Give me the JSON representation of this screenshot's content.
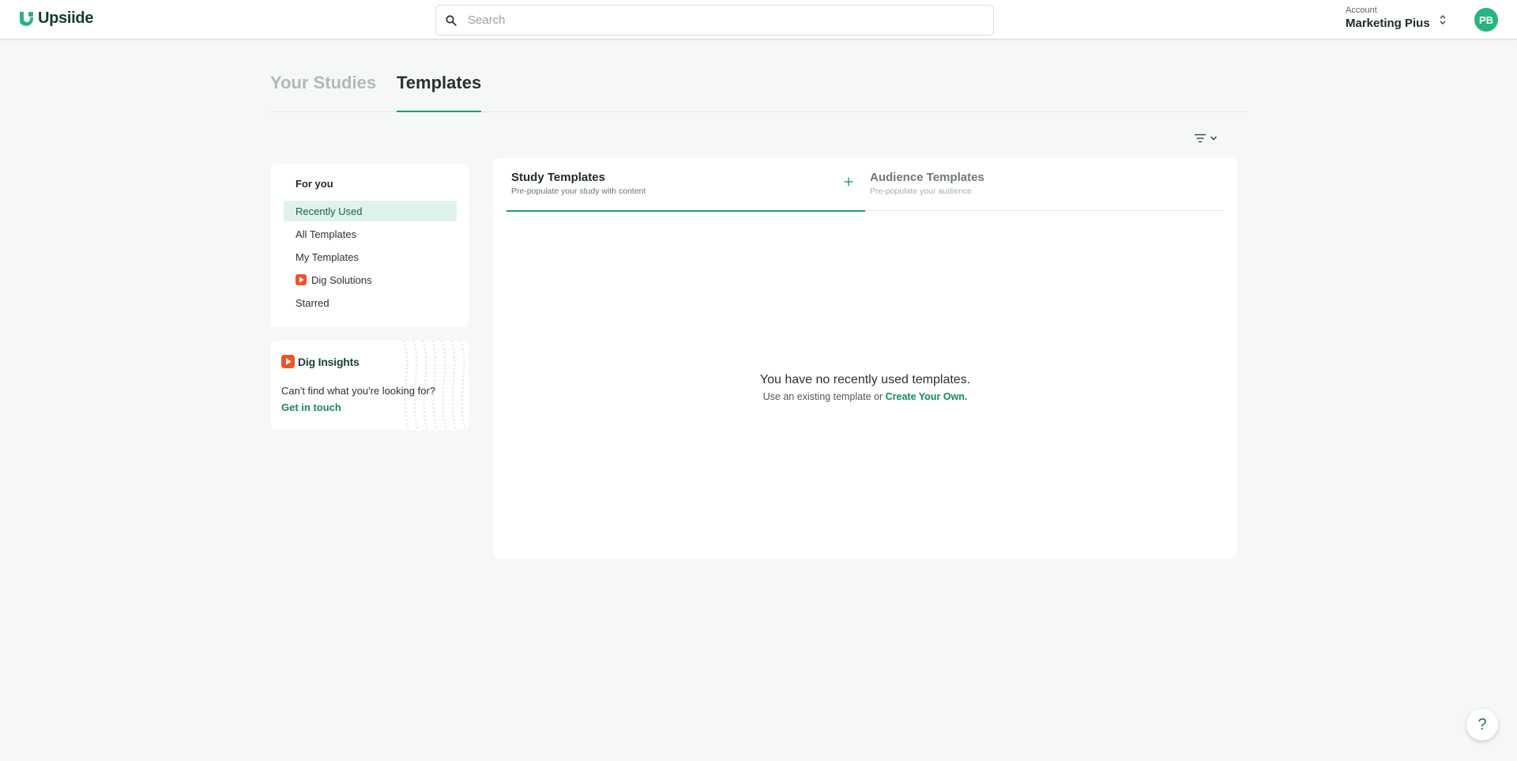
{
  "header": {
    "brand": "Upsiide",
    "search": {
      "placeholder": "Search",
      "value": ""
    },
    "account": {
      "label": "Account",
      "name": "Marketing Pius"
    },
    "avatar_initials": "PB"
  },
  "page_tabs": [
    {
      "label": "Your Studies",
      "active": false
    },
    {
      "label": "Templates",
      "active": true
    }
  ],
  "sidebar": {
    "heading": "For you",
    "items": [
      {
        "label": "Recently Used",
        "active": true
      },
      {
        "label": "All Templates",
        "active": false
      },
      {
        "label": "My Templates",
        "active": false
      },
      {
        "label": "Dig Solutions",
        "active": false,
        "icon": "dig-icon"
      },
      {
        "label": "Starred",
        "active": false
      }
    ]
  },
  "promo": {
    "brand": "Dig Insights",
    "text": "Can't find what you're looking for?",
    "link": "Get in touch"
  },
  "template_tabs": [
    {
      "title": "Study Templates",
      "subtitle": "Pre-populate your study with content",
      "active": true
    },
    {
      "title": "Audience Templates",
      "subtitle": "Pre-populate your audience",
      "active": false
    }
  ],
  "empty_state": {
    "title": "You have no recently used templates.",
    "subtitle_prefix": "Use an existing template or ",
    "link": "Create Your Own."
  },
  "help_label": "?",
  "colors": {
    "accent": "#1e9c77",
    "brand": "#27b57f",
    "dig": "#f0532b"
  }
}
